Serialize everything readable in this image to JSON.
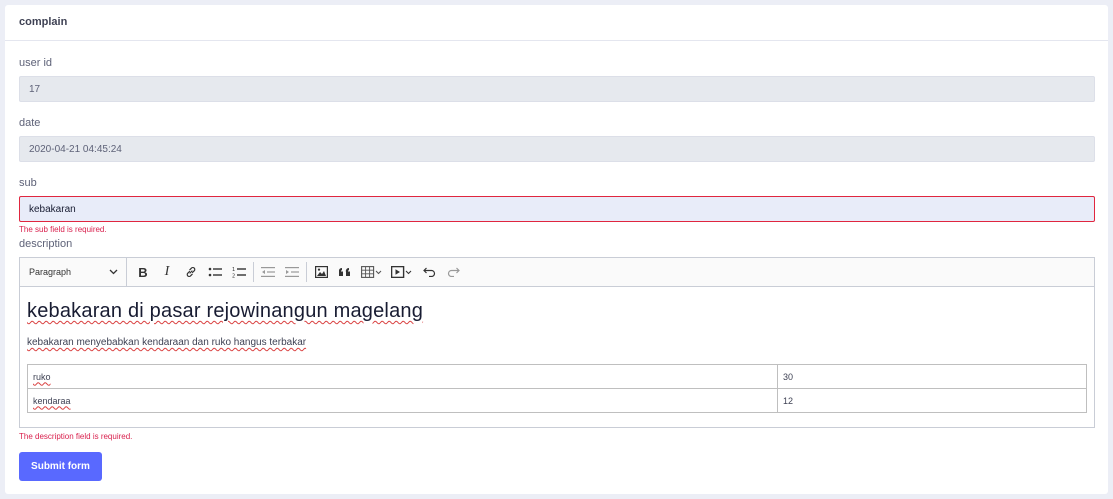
{
  "card": {
    "title": "complain"
  },
  "fields": {
    "user_id": {
      "label": "user id",
      "value": "17"
    },
    "date": {
      "label": "date",
      "value": "2020-04-21 04:45:24"
    },
    "sub": {
      "label": "sub",
      "value": "kebakaran",
      "error": "The sub field is required."
    },
    "description": {
      "label": "description",
      "error": "The description field is required."
    }
  },
  "toolbar": {
    "heading_select": "Paragraph",
    "buttons": [
      "bold-icon",
      "italic-icon",
      "link-icon",
      "bulleted-list-icon",
      "numbered-list-icon",
      "outdent-icon",
      "indent-icon",
      "image-icon",
      "blockquote-icon",
      "table-icon",
      "media-icon",
      "undo-icon",
      "redo-icon"
    ]
  },
  "editor": {
    "heading": "kebakaran di pasar rejowinangun magelang",
    "paragraph": "kebakaran menyebabkan kendaraan dan ruko hangus terbakar",
    "table": [
      {
        "name": "ruko",
        "value": "30"
      },
      {
        "name": "kendaraa",
        "value": "12"
      }
    ]
  },
  "submit_label": "Submit form",
  "colors": {
    "accent": "#5969ff",
    "error": "#d9214e"
  }
}
